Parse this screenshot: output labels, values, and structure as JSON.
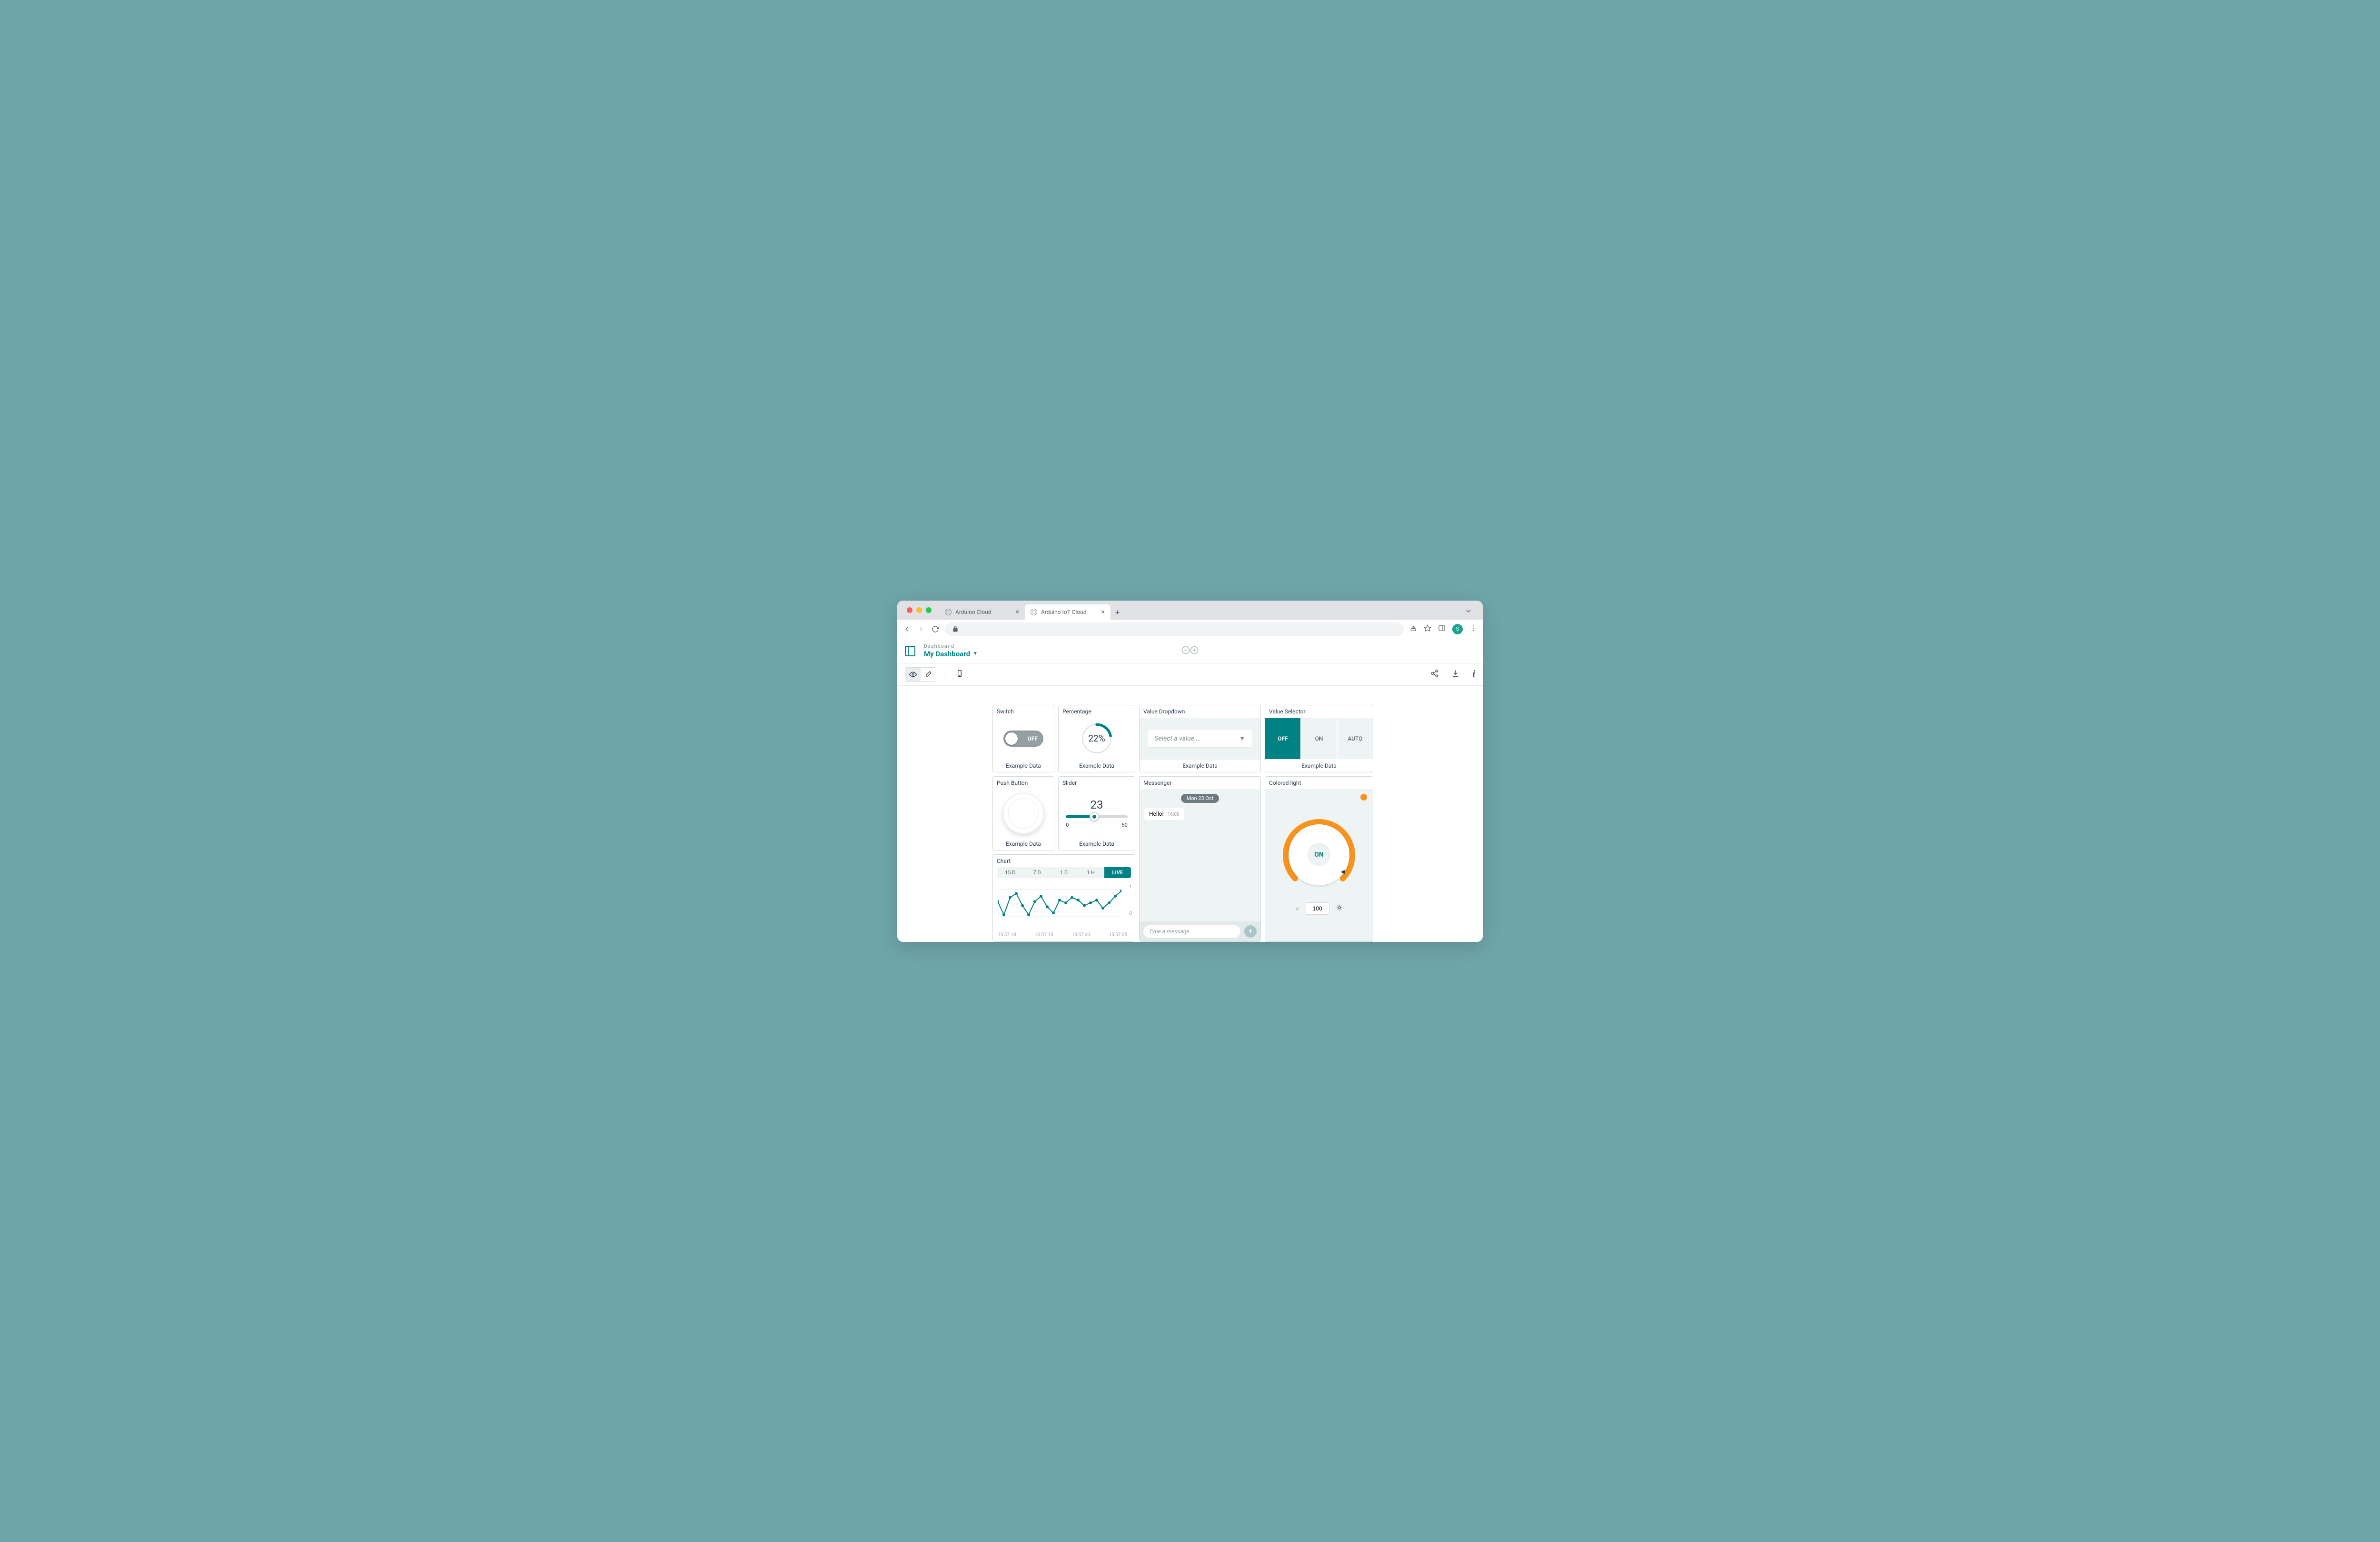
{
  "browser": {
    "tabs": [
      {
        "title": "Arduino Cloud",
        "active": false
      },
      {
        "title": "Arduino IoT Cloud",
        "active": true
      }
    ],
    "avatar_initial": "S"
  },
  "header": {
    "crumb": "Dashboard",
    "title": "My Dashboard"
  },
  "widgets": {
    "switch": {
      "title": "Switch",
      "state": "OFF",
      "footer": "Example Data"
    },
    "percentage": {
      "title": "Percentage",
      "value": 22,
      "display": "22%",
      "footer": "Example Data"
    },
    "dropdown": {
      "title": "Value Dropdown",
      "placeholder": "Select a value...",
      "footer": "Example Data"
    },
    "selector": {
      "title": "Value Selector",
      "options": [
        "OFF",
        "ON",
        "AUTO"
      ],
      "selected": "OFF",
      "footer": "Example Data"
    },
    "push": {
      "title": "Push Button",
      "footer": "Example Data"
    },
    "slider": {
      "title": "Slider",
      "value": 23,
      "min": 0,
      "max": 50,
      "footer": "Example Data"
    },
    "messenger": {
      "title": "Messenger",
      "date": "Mon 23 Oct",
      "msg": "Hello!",
      "time": "16:00",
      "placeholder": "Type a message"
    },
    "light": {
      "title": "Colored light",
      "state": "ON",
      "brightness": 100,
      "color": "#f7931e"
    },
    "chart": {
      "title": "Chart",
      "ranges": [
        "15 D",
        "7 D",
        "1 D",
        "1 H",
        "LIVE"
      ],
      "active_range": "LIVE",
      "x_ticks": [
        "15:57:10",
        "15:57:15",
        "15:57:20",
        "15:57:25"
      ],
      "y_ticks": [
        "1",
        "0"
      ]
    }
  },
  "chart_data": {
    "type": "line",
    "title": "",
    "xlabel": "",
    "ylabel": "",
    "ylim": [
      0,
      1
    ],
    "x": [
      "15:57:08",
      "15:57:09",
      "15:57:10",
      "15:57:11",
      "15:57:12",
      "15:57:13",
      "15:57:14",
      "15:57:15",
      "15:57:16",
      "15:57:17",
      "15:57:18",
      "15:57:19",
      "15:57:20",
      "15:57:21",
      "15:57:22",
      "15:57:23",
      "15:57:24",
      "15:57:25",
      "15:57:26",
      "15:57:27",
      "15:57:28"
    ],
    "values": [
      0.55,
      0.05,
      0.7,
      0.85,
      0.4,
      0.05,
      0.55,
      0.75,
      0.35,
      0.12,
      0.6,
      0.5,
      0.7,
      0.6,
      0.4,
      0.5,
      0.6,
      0.3,
      0.5,
      0.75,
      0.95
    ]
  }
}
